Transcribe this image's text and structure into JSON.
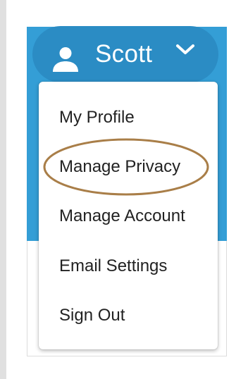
{
  "user": {
    "name": "Scott"
  },
  "icons": {
    "user": "person-icon",
    "dropdown": "chevron-down-icon"
  },
  "menu": {
    "items": [
      {
        "label": "My Profile"
      },
      {
        "label": "Manage Privacy",
        "highlighted": true
      },
      {
        "label": "Manage Account"
      },
      {
        "label": "Email Settings"
      },
      {
        "label": "Sign Out"
      }
    ]
  },
  "colors": {
    "header_blue": "#349ed6",
    "pill_blue": "#2b8cc4",
    "highlight_ring": "#a97e48"
  }
}
